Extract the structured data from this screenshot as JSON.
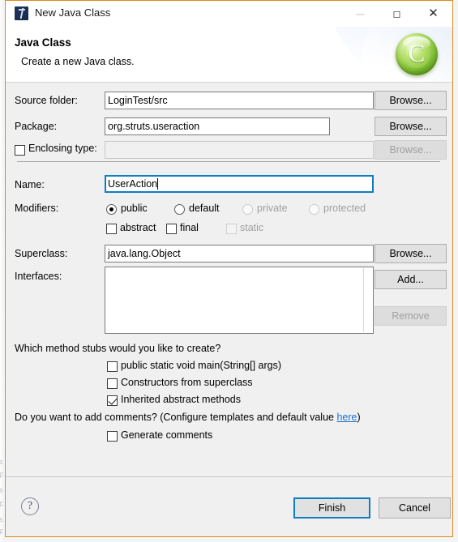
{
  "window": {
    "title": "New Java Class",
    "icon": "java-class-icon",
    "controls": {
      "minimize": "—",
      "maximize": "☐",
      "close": "✕"
    },
    "border_color": "#e08c1e"
  },
  "banner": {
    "title": "Java Class",
    "subtitle": "Create a new Java class.",
    "logo_letter": "C",
    "logo_color": "#8fce45"
  },
  "form": {
    "source_folder": {
      "label": "Source folder:",
      "value": "LoginTest/src",
      "browse": "Browse..."
    },
    "package": {
      "label": "Package:",
      "value": "org.struts.useraction",
      "browse": "Browse..."
    },
    "enclosing_type": {
      "label": "Enclosing type:",
      "value": "",
      "checked": false,
      "browse": "Browse...",
      "enabled": false
    },
    "name": {
      "label": "Name:",
      "value": "UserAction",
      "focused": true
    },
    "modifiers": {
      "label": "Modifiers:",
      "access": [
        {
          "label": "public",
          "selected": true,
          "enabled": true
        },
        {
          "label": "default",
          "selected": false,
          "enabled": true
        },
        {
          "label": "private",
          "selected": false,
          "enabled": false
        },
        {
          "label": "protected",
          "selected": false,
          "enabled": false
        }
      ],
      "flags": [
        {
          "label": "abstract",
          "checked": false,
          "enabled": true
        },
        {
          "label": "final",
          "checked": false,
          "enabled": true
        },
        {
          "label": "static",
          "checked": false,
          "enabled": false
        }
      ]
    },
    "superclass": {
      "label": "Superclass:",
      "value": "java.lang.Object",
      "browse": "Browse..."
    },
    "interfaces": {
      "label": "Interfaces:",
      "items": [],
      "add": "Add...",
      "remove": "Remove",
      "remove_enabled": false
    }
  },
  "stubs": {
    "question": "Which method stubs would you like to create?",
    "options": [
      {
        "label": "public static void main(String[] args)",
        "checked": false
      },
      {
        "label": "Constructors from superclass",
        "checked": false
      },
      {
        "label": "Inherited abstract methods",
        "checked": true
      }
    ]
  },
  "comments": {
    "question_before": "Do you want to add comments? (Configure templates and default value ",
    "link": "here",
    "question_after": ")",
    "option": {
      "label": "Generate comments",
      "checked": false
    }
  },
  "footer": {
    "help": "?",
    "finish": "Finish",
    "cancel": "Cancel"
  },
  "underlay_ghost_lines": [
    "s",
    "F",
    "s",
    "F",
    "s",
    "F"
  ]
}
